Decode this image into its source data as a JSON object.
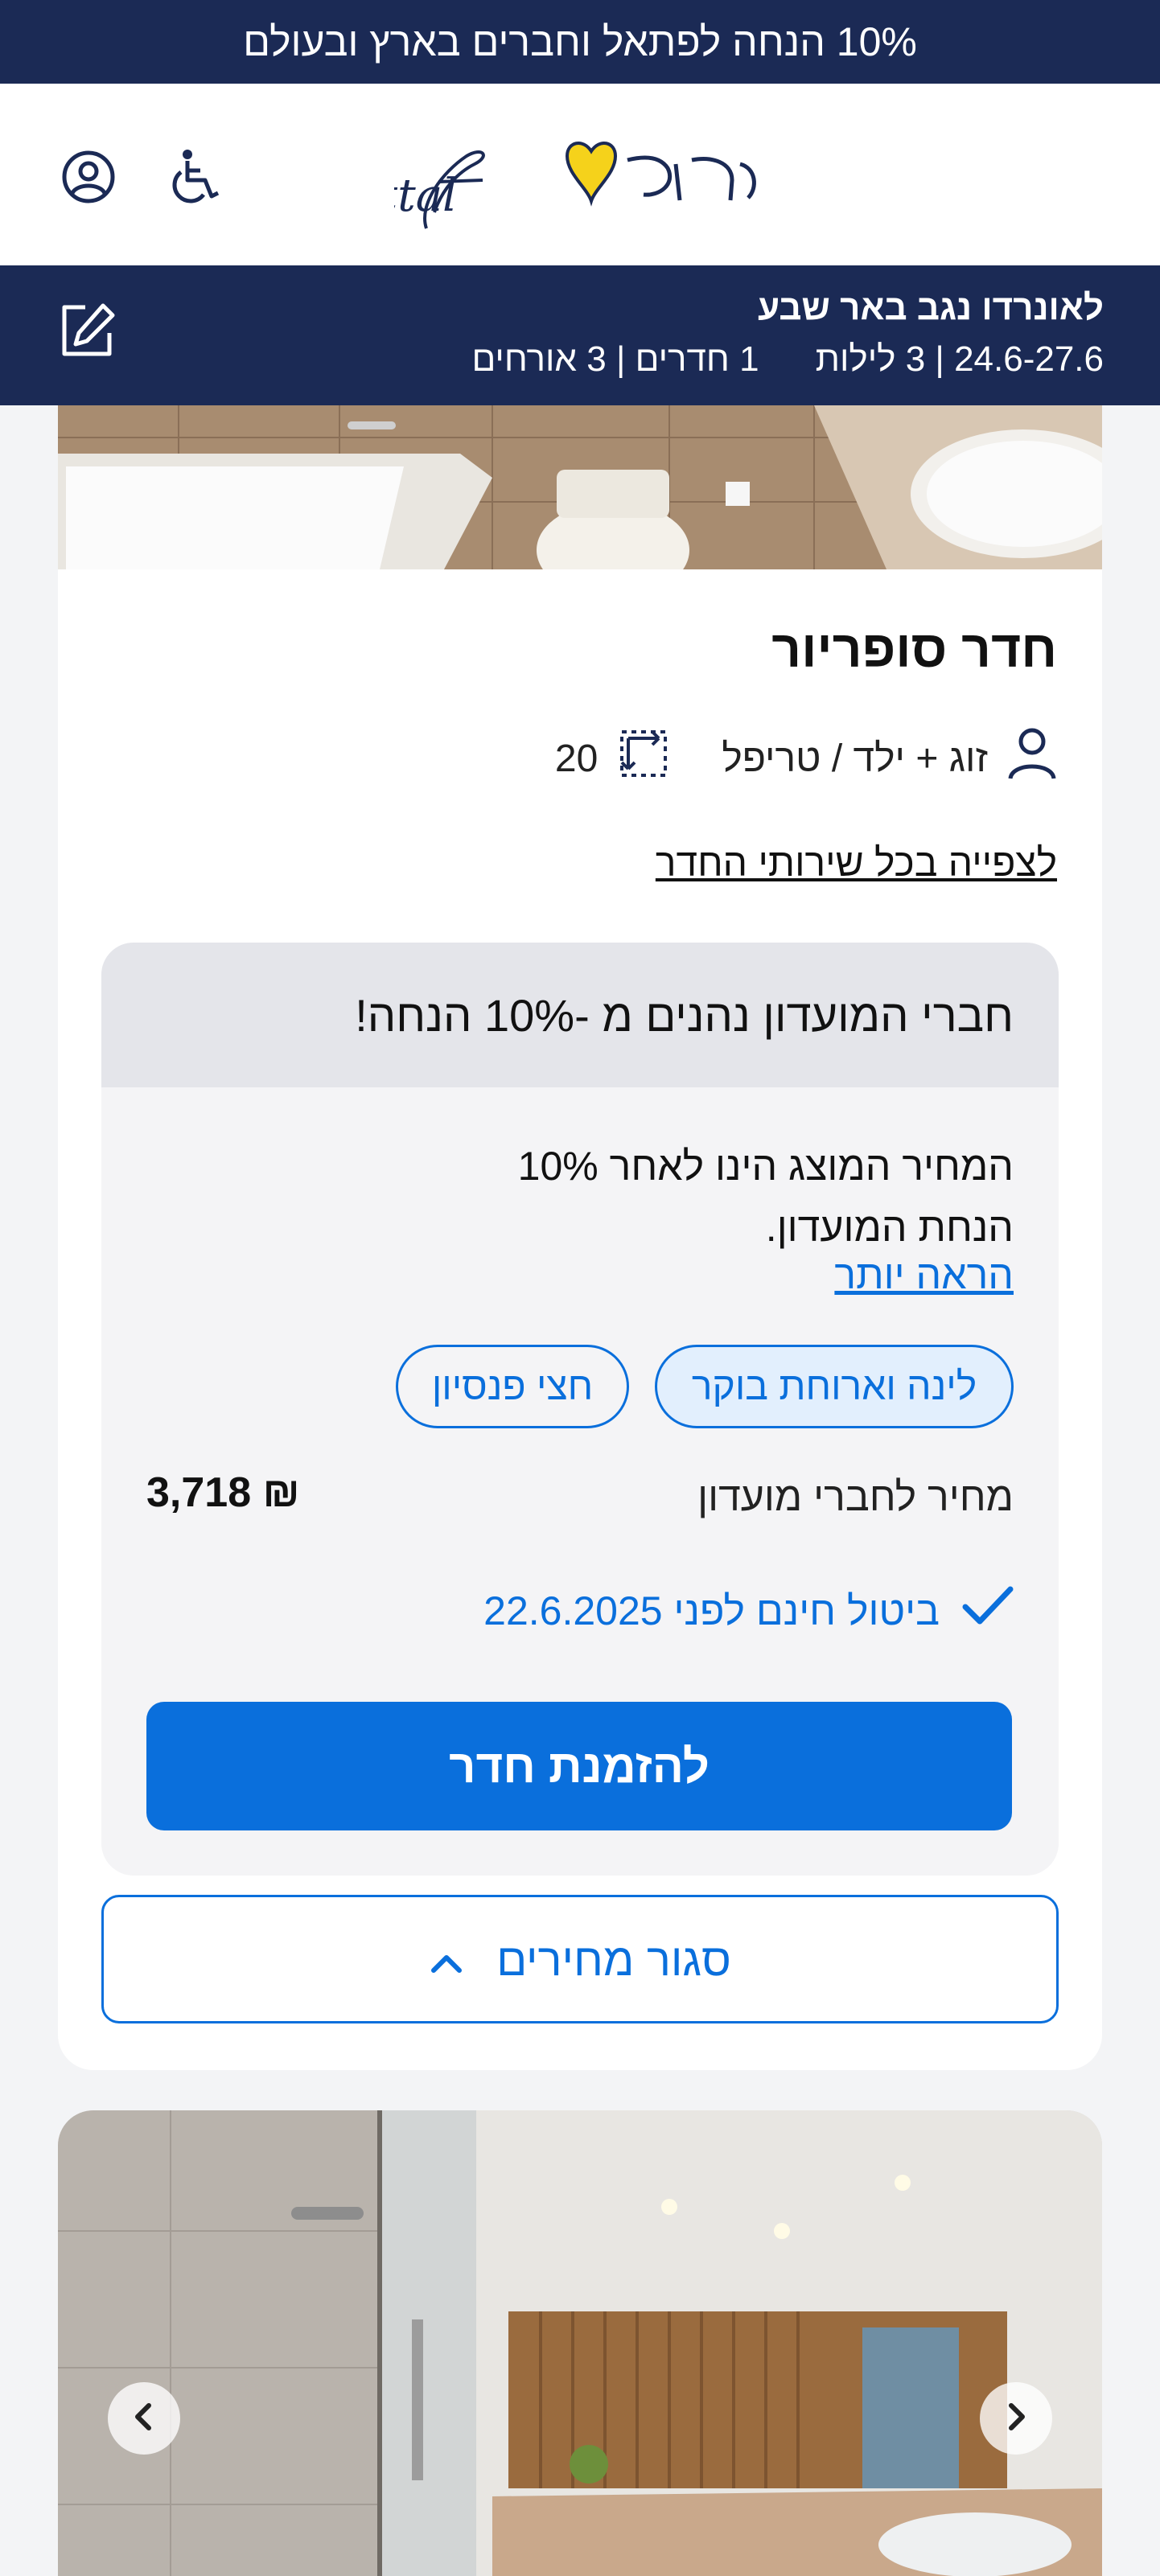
{
  "promo": {
    "text": "10% הנחה לפתאל וחברים בארץ ובעולם"
  },
  "header": {
    "logo_alt": "fattal פתאל",
    "accessibility_icon": "wheelchair-icon",
    "account_icon": "user-circle-icon"
  },
  "summary": {
    "hotel": "לאונרדו נגב באר שבע",
    "dates_nights": "24.6-27.6 | 3 לילות",
    "rooms_guests": "1 חדרים | 3 אורחים",
    "edit_icon": "edit-icon"
  },
  "room": {
    "title": "חדר סופריור",
    "occupancy": "זוג + ילד / טריפל",
    "size": "20",
    "services_link": "לצפייה בכל שירותי החדר"
  },
  "club": {
    "heading": "חברי המועדון נהנים מ -10% הנחה!",
    "description": "המחיר המוצג הינו לאחר 10% הנחת המועדון.",
    "more_link": "הראה יותר",
    "board_options": [
      "לינה וארוחת בוקר",
      "חצי פנסיון"
    ],
    "selected_board": "לינה וארוחת בוקר",
    "price_label": "מחיר לחברי מועדון",
    "price": "₪ 3,718",
    "cancellation": "ביטול חינם לפני 22.6.2025",
    "book_button": "להזמנת חדר"
  },
  "close_prices": "סגור מחירים",
  "colors": {
    "navy": "#1b2a55",
    "accent_blue": "#0a6fdc",
    "logo_yellow": "#f5d21b"
  }
}
